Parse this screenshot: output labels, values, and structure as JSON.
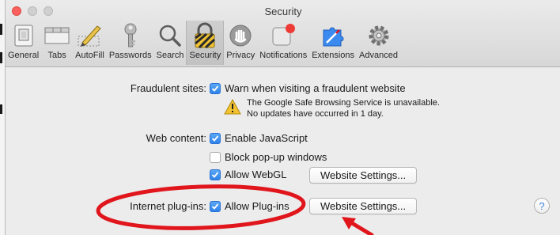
{
  "window": {
    "title": "Security"
  },
  "toolbar": {
    "items": [
      {
        "label": "General",
        "icon": "general-icon"
      },
      {
        "label": "Tabs",
        "icon": "tabs-icon"
      },
      {
        "label": "AutoFill",
        "icon": "autofill-icon"
      },
      {
        "label": "Passwords",
        "icon": "key-icon"
      },
      {
        "label": "Search",
        "icon": "magnifier-icon"
      },
      {
        "label": "Security",
        "icon": "lock-icon",
        "active": true
      },
      {
        "label": "Privacy",
        "icon": "hand-icon"
      },
      {
        "label": "Notifications",
        "icon": "notifications-icon"
      },
      {
        "label": "Extensions",
        "icon": "puzzle-icon"
      },
      {
        "label": "Advanced",
        "icon": "gears-icon"
      }
    ]
  },
  "security": {
    "fraud": {
      "label": "Fraudulent sites:",
      "option": "Warn when visiting a fraudulent website",
      "checked": true,
      "warning_line1": "The Google Safe Browsing Service is unavailable.",
      "warning_line2": "No updates have occurred in 1 day."
    },
    "web_content": {
      "label": "Web content:",
      "javascript": "Enable JavaScript",
      "popups": "Block pop-up windows",
      "webgl": "Allow WebGL",
      "webgl_settings": "Website Settings..."
    },
    "plugins": {
      "label": "Internet plug-ins:",
      "option": "Allow Plug-ins",
      "settings": "Website Settings..."
    },
    "help": "?"
  },
  "colors": {
    "accent": "#3b8af0",
    "annotation": "#e0161c"
  }
}
